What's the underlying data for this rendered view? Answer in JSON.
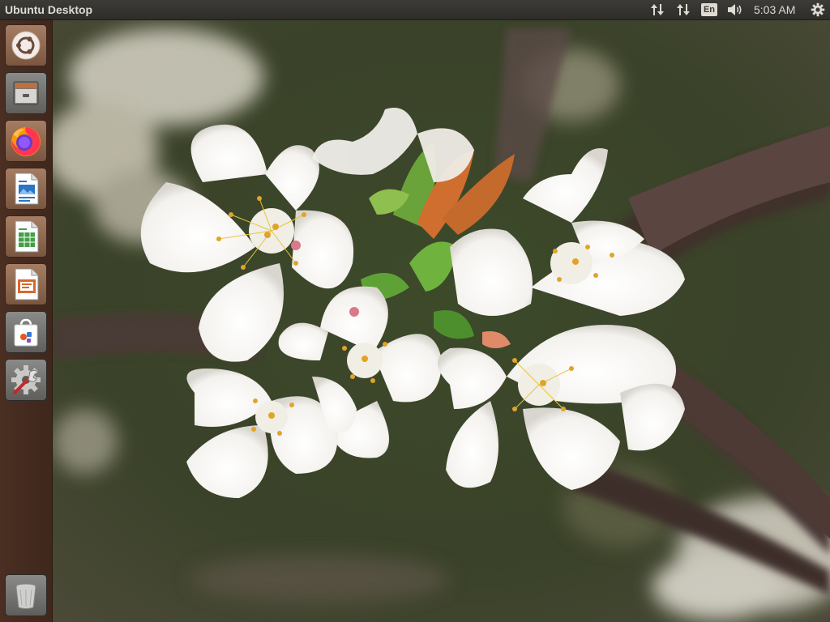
{
  "top_panel": {
    "title": "Ubuntu Desktop",
    "indicators": [
      "network-transfer-icon",
      "network-transfer-icon",
      "keyboard-layout",
      "volume-icon"
    ],
    "keyboard_layout": "En",
    "clock": "5:03 AM",
    "session_icon": "gear-power-icon"
  },
  "launcher": {
    "items": [
      {
        "name": "dash-home",
        "icon": "ubuntu-logo-icon"
      },
      {
        "name": "files",
        "icon": "file-cabinet-icon"
      },
      {
        "name": "firefox",
        "icon": "firefox-icon"
      },
      {
        "name": "libreoffice-writer",
        "icon": "writer-doc-icon"
      },
      {
        "name": "libreoffice-calc",
        "icon": "calc-sheet-icon"
      },
      {
        "name": "libreoffice-impress",
        "icon": "impress-slide-icon"
      },
      {
        "name": "ubuntu-software",
        "icon": "shopping-bag-icon"
      },
      {
        "name": "system-settings",
        "icon": "gear-wrench-icon"
      }
    ],
    "trash": {
      "name": "trash",
      "icon": "trash-bin-icon"
    }
  },
  "desktop": {
    "wallpaper": "cherry-blossom"
  },
  "colors": {
    "panel_bg": "#3c3b37",
    "panel_text": "#dfdbd2",
    "launcher_bg": "#45291f",
    "ubuntu_orange": "#e95420"
  }
}
